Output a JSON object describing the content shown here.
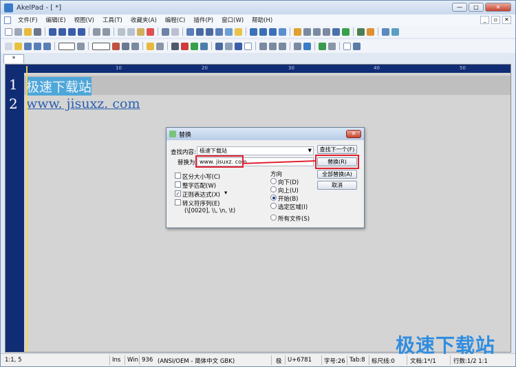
{
  "window": {
    "title": "AkelPad - [ *]",
    "btn_min": "—",
    "btn_max": "□",
    "btn_close": "✕"
  },
  "menu": [
    "文件(F)",
    "编辑(E)",
    "视图(V)",
    "工具(T)",
    "收藏夹(A)",
    "编程(C)",
    "插件(P)",
    "窗口(W)",
    "帮助(H)"
  ],
  "mdi": {
    "min": "_",
    "restore": "▫",
    "close": "✕"
  },
  "tab": {
    "label": "*"
  },
  "ruler": {
    "marks": [
      "10",
      "20",
      "30",
      "40",
      "50"
    ]
  },
  "editor": {
    "lines": [
      {
        "num": "1",
        "text": "极速下载站"
      },
      {
        "num": "2",
        "text": "www. jisuxz. com"
      }
    ]
  },
  "dialog": {
    "title": "替换",
    "close": "✕",
    "find_label": "查找内容:",
    "find_value": "极速下载站",
    "replace_label": "替换为:",
    "replace_value": "www. jisuxz. com",
    "btn_find_next": "查找下一个(F)",
    "btn_replace": "替换(R)",
    "btn_replace_all": "全部替换(A)",
    "btn_cancel": "取消",
    "options": [
      {
        "label": "区分大小写(C)",
        "checked": false
      },
      {
        "label": "整字匹配(W)",
        "checked": false
      },
      {
        "label": "正则表达式(X)",
        "checked": true
      },
      {
        "label": "转义符序列(E)",
        "checked": false
      }
    ],
    "escape_hint": "(\\[0020], \\\\, \\n, \\t)",
    "direction_title": "方向",
    "directions": [
      {
        "label": "向下(D)",
        "selected": false
      },
      {
        "label": "向上(U)",
        "selected": false
      },
      {
        "label": "开始(B)",
        "selected": true
      },
      {
        "label": "选定区域(I)",
        "selected": false
      }
    ],
    "all_files": "所有文件(S)"
  },
  "status": {
    "pos": "1:1, 5",
    "ins": "Ins",
    "eol": "Win",
    "codepage": "936",
    "encoding": "(ANSI/OEM - 简体中文 GBK)",
    "char_glyph": "极",
    "unicode": "U+6781",
    "chars": "字号:26",
    "tab": "Tab:8",
    "ruler": "标尺线:0",
    "file": "文档:1*/1",
    "lines": "行数:1/2 1:1"
  },
  "watermark": "极速下载站",
  "colors": {
    "selection": "#4fa6d9",
    "gutter": "#102c74",
    "annotation": "#e0212f",
    "watermark": "#2f8de0"
  }
}
